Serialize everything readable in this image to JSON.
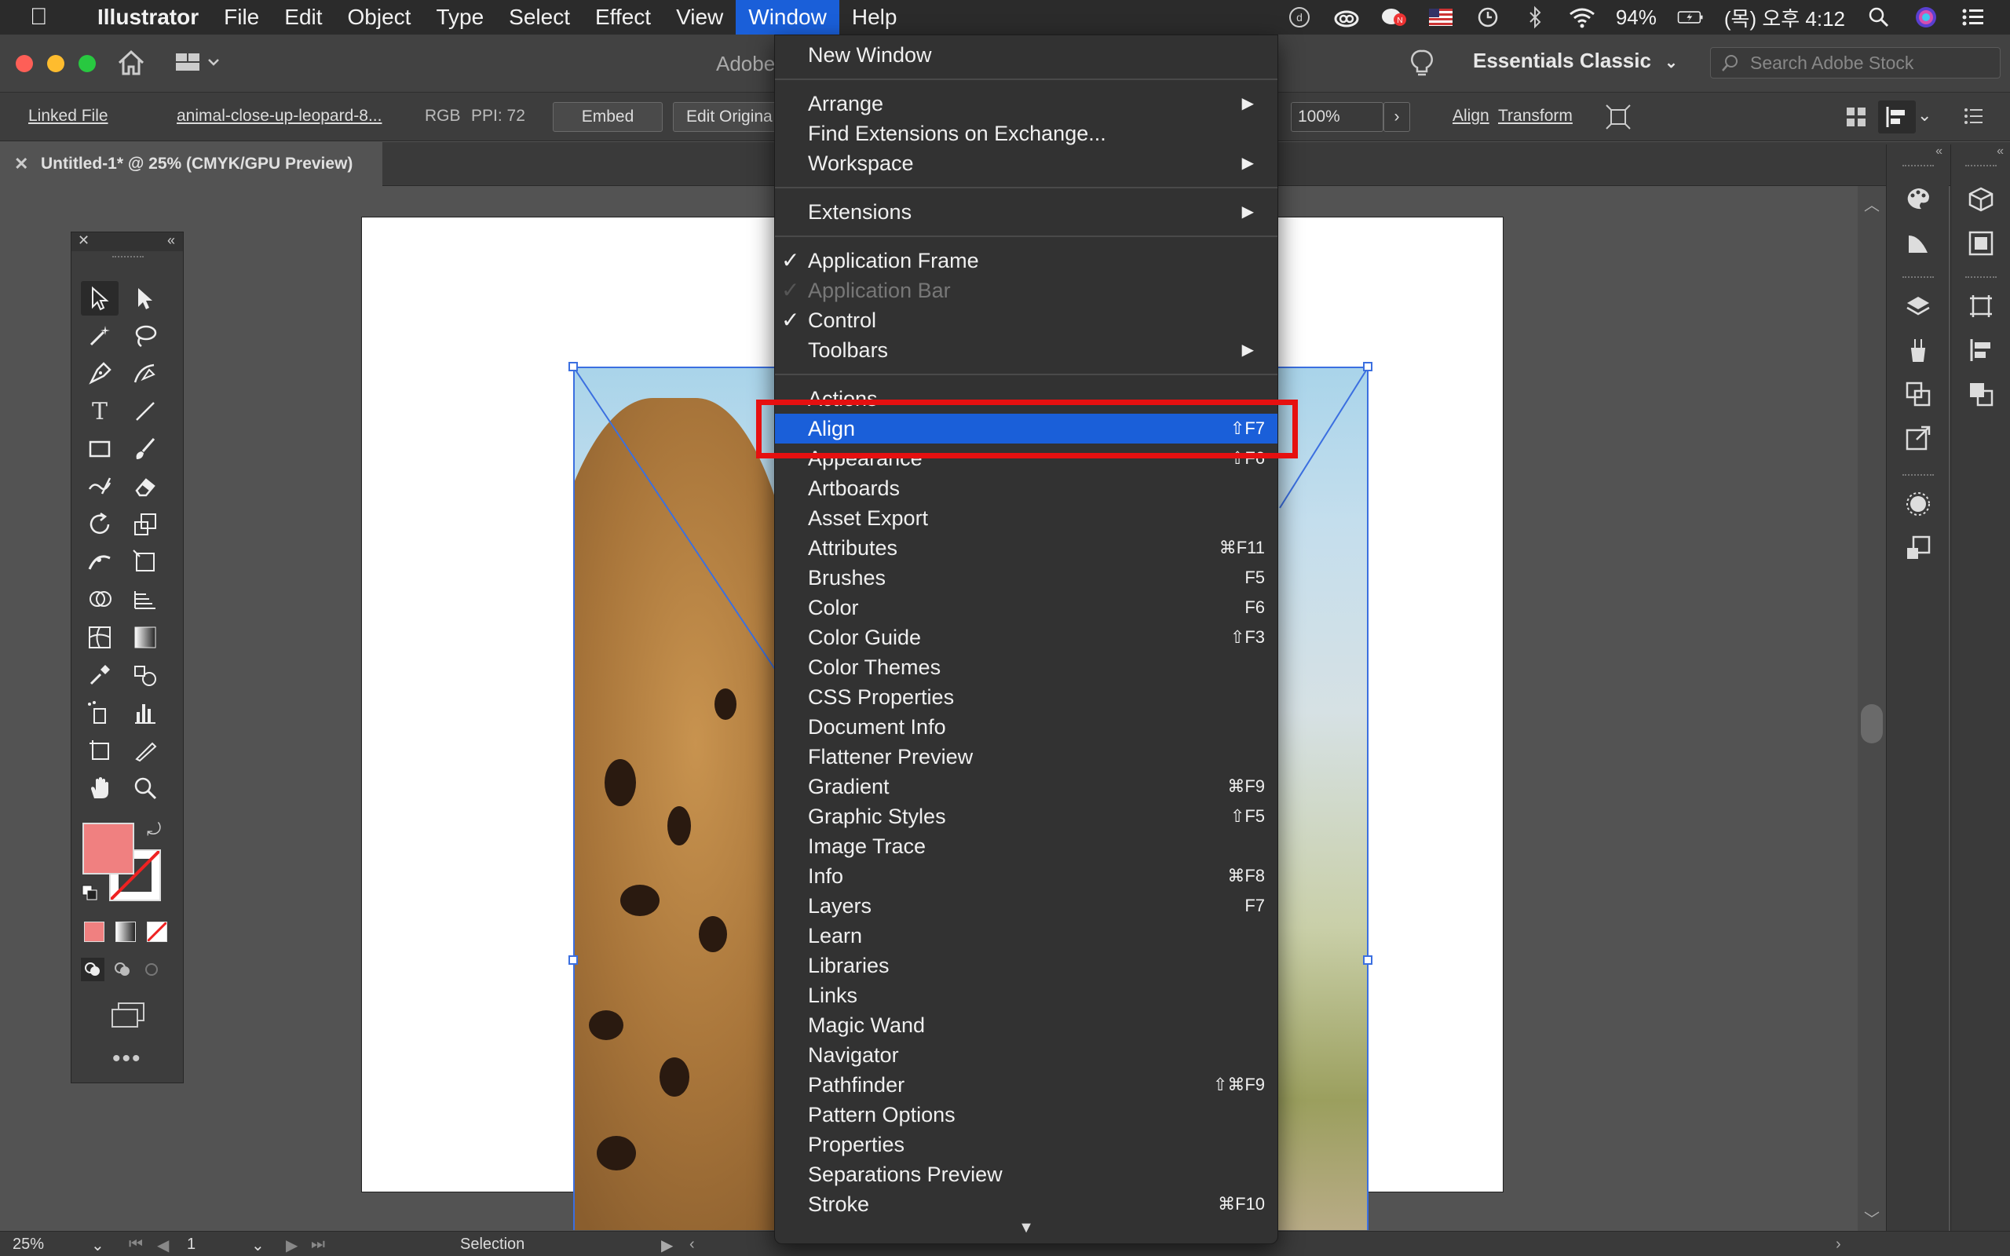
{
  "menubar": {
    "app_name": "Illustrator",
    "items": [
      "File",
      "Edit",
      "Object",
      "Type",
      "Select",
      "Effect",
      "View",
      "Window",
      "Help"
    ],
    "active_item": "Window",
    "battery": "94%",
    "clock": "(목) 오후 4:12"
  },
  "appbar": {
    "title_partial": "Adobe",
    "workspace": "Essentials Classic",
    "search_placeholder": "Search Adobe Stock"
  },
  "controlbar": {
    "linked_file": "Linked File",
    "filename": "animal-close-up-leopard-8...",
    "color_mode": "RGB",
    "ppi": "PPI: 72",
    "embed": "Embed",
    "edit_original": "Edit Origina",
    "opacity_value": "100%",
    "align": "Align",
    "transform": "Transform"
  },
  "document": {
    "tab_title": "Untitled-1* @ 25% (CMYK/GPU Preview)"
  },
  "statusbar": {
    "zoom": "25%",
    "artboard_num": "1",
    "tool": "Selection"
  },
  "colors": {
    "fill": "#f08080",
    "menu_highlight": "#1a5fd9",
    "annotation": "#e61010"
  },
  "window_menu": {
    "items": [
      {
        "label": "New Window"
      },
      {
        "label": "Arrange",
        "submenu": true
      },
      {
        "label": "Find Extensions on Exchange..."
      },
      {
        "label": "Workspace",
        "submenu": true
      },
      {
        "label": "Extensions",
        "submenu": true
      },
      {
        "label": "Application Frame",
        "checked": true
      },
      {
        "label": "Application Bar",
        "checked": true,
        "disabled": true
      },
      {
        "label": "Control",
        "checked": true
      },
      {
        "label": "Toolbars",
        "submenu": true
      },
      {
        "label": "Actions"
      },
      {
        "label": "Align",
        "shortcut": "⇧F7",
        "highlighted": true
      },
      {
        "label": "Appearance",
        "shortcut": "⇧F6"
      },
      {
        "label": "Artboards"
      },
      {
        "label": "Asset Export"
      },
      {
        "label": "Attributes",
        "shortcut": "⌘F11"
      },
      {
        "label": "Brushes",
        "shortcut": "F5"
      },
      {
        "label": "Color",
        "shortcut": "F6"
      },
      {
        "label": "Color Guide",
        "shortcut": "⇧F3"
      },
      {
        "label": "Color Themes"
      },
      {
        "label": "CSS Properties"
      },
      {
        "label": "Document Info"
      },
      {
        "label": "Flattener Preview"
      },
      {
        "label": "Gradient",
        "shortcut": "⌘F9"
      },
      {
        "label": "Graphic Styles",
        "shortcut": "⇧F5"
      },
      {
        "label": "Image Trace"
      },
      {
        "label": "Info",
        "shortcut": "⌘F8"
      },
      {
        "label": "Layers",
        "shortcut": "F7"
      },
      {
        "label": "Learn"
      },
      {
        "label": "Libraries"
      },
      {
        "label": "Links"
      },
      {
        "label": "Magic Wand"
      },
      {
        "label": "Navigator"
      },
      {
        "label": "Pathfinder",
        "shortcut": "⇧⌘F9"
      },
      {
        "label": "Pattern Options"
      },
      {
        "label": "Properties"
      },
      {
        "label": "Separations Preview"
      },
      {
        "label": "Stroke",
        "shortcut": "⌘F10"
      }
    ]
  }
}
